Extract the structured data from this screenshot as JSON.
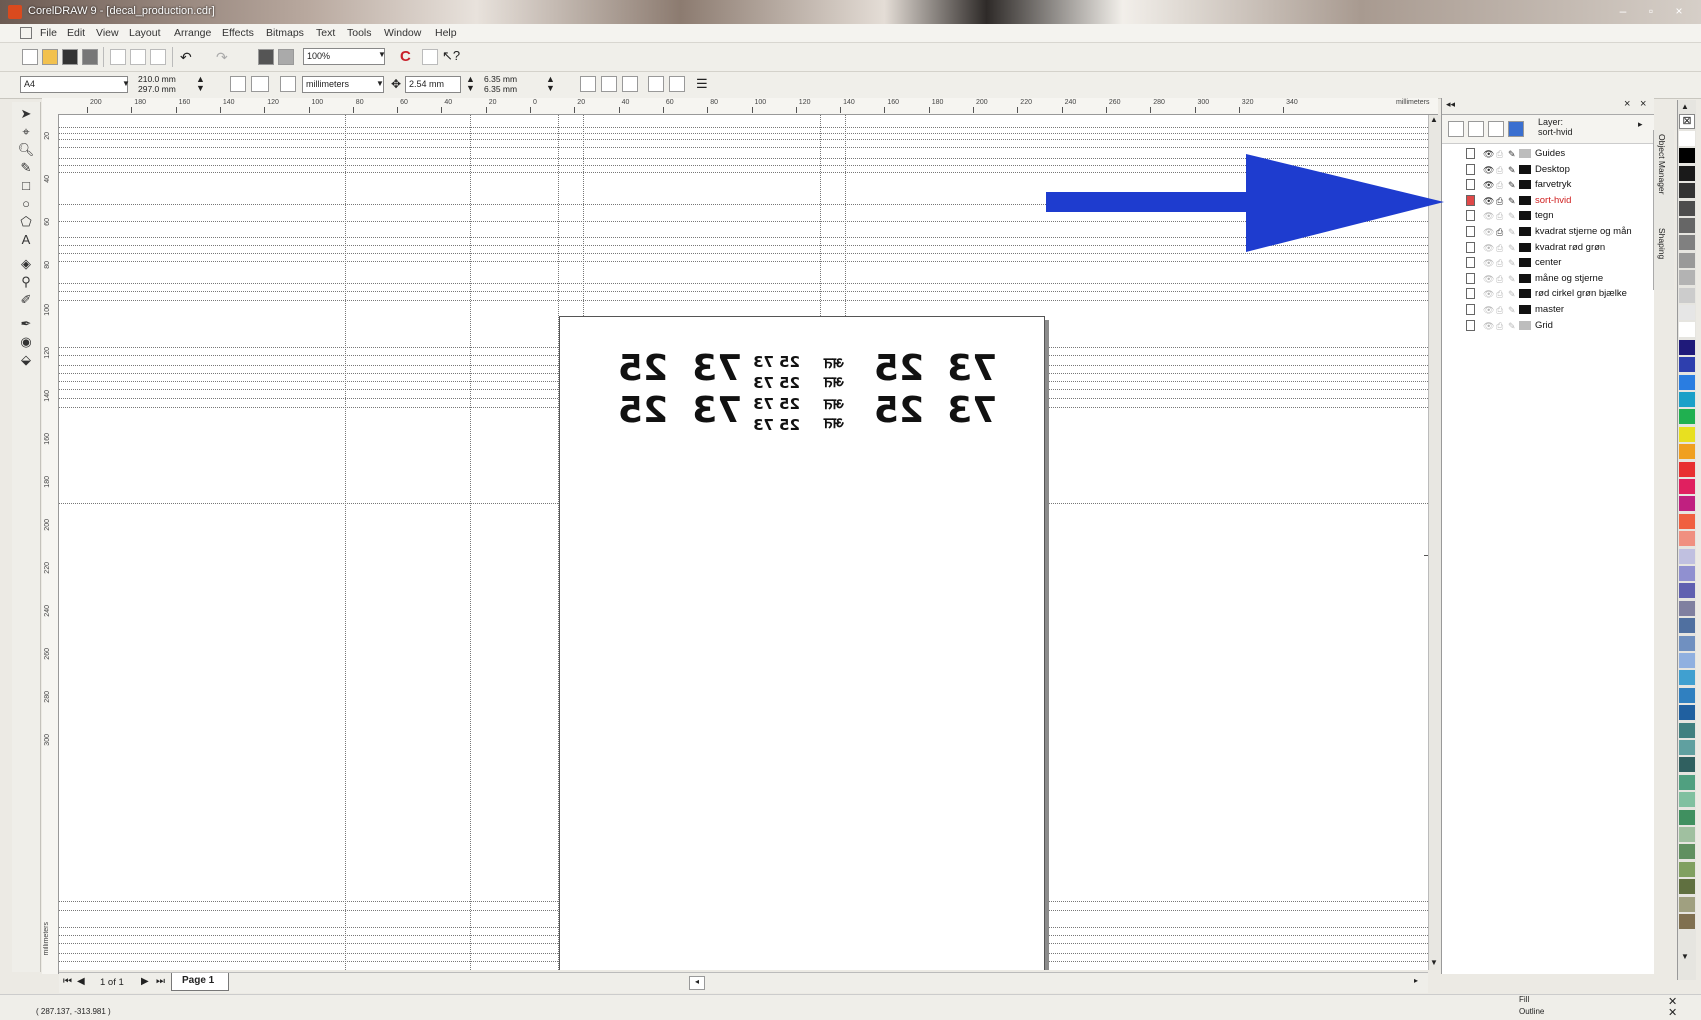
{
  "window": {
    "title": "CorelDRAW 9 - [decal_production.cdr]",
    "controls": [
      "–",
      "▫",
      "×"
    ]
  },
  "menu": [
    "File",
    "Edit",
    "View",
    "Layout",
    "Arrange",
    "Effects",
    "Bitmaps",
    "Text",
    "Tools",
    "Window",
    "Help"
  ],
  "toolbar": {
    "zoom": "100%"
  },
  "property_bar": {
    "paper_size": "A4",
    "width": "210.0 mm",
    "height": "297.0 mm",
    "units": "millimeters",
    "nudge": "2.54 mm",
    "dup_x": "6.35 mm",
    "dup_y": "6.35 mm"
  },
  "ruler": {
    "unit_label": "millimeters",
    "h_ticks": [
      "200",
      "180",
      "160",
      "140",
      "120",
      "100",
      "80",
      "60",
      "40",
      "20",
      "0",
      "20",
      "40",
      "60",
      "80",
      "100",
      "120",
      "140",
      "160",
      "180",
      "200",
      "220",
      "240",
      "260",
      "280",
      "300",
      "320",
      "340"
    ],
    "v_ticks": [
      "20",
      "40",
      "60",
      "80",
      "100",
      "120",
      "140",
      "160",
      "180",
      "200",
      "220",
      "240",
      "260",
      "280",
      "300"
    ],
    "v_unit_label": "millimeters"
  },
  "page_content": {
    "rows": [
      [
        "25",
        "73",
        "25",
        "73"
      ],
      [
        "25",
        "73",
        "25",
        "73"
      ]
    ],
    "small": {
      "col1": [
        "25 73",
        "25 73",
        "25 73",
        "25 73"
      ],
      "col2": [
        "अत",
        "अत",
        "अत",
        "अत"
      ]
    }
  },
  "page_nav": {
    "counter": "1 of 1",
    "page_tab": "Page 1"
  },
  "status": {
    "coords": "( 287.137, -313.981 )",
    "fill_label": "Fill",
    "outline_label": "Outline"
  },
  "layers_docker": {
    "title_line1": "Layer:",
    "title_line2": "sort-hvid",
    "tabs": [
      "Object Manager",
      "Shaping"
    ],
    "layers": [
      {
        "name": "Guides",
        "active": false
      },
      {
        "name": "Desktop",
        "active": false
      },
      {
        "name": "farvetryk",
        "active": false
      },
      {
        "name": "sort-hvid",
        "active": true
      },
      {
        "name": "tegn",
        "active": false
      },
      {
        "name": "kvadrat stjerne og mån",
        "active": false
      },
      {
        "name": "kvadrat rød grøn",
        "active": false
      },
      {
        "name": "center",
        "active": false
      },
      {
        "name": "måne og stjerne",
        "active": false
      },
      {
        "name": "rød cirkel grøn bjælke",
        "active": false
      },
      {
        "name": "master",
        "active": false
      },
      {
        "name": "Grid",
        "active": false
      }
    ]
  },
  "palette_colors": [
    "#ffffff",
    "#000000",
    "#1a1a1a",
    "#333333",
    "#4d4d4d",
    "#666666",
    "#808080",
    "#999999",
    "#b3b3b3",
    "#cccccc",
    "#e6e6e6",
    "#ffffff",
    "#1f1a7a",
    "#2e3fae",
    "#2a7de1",
    "#1aa0c8",
    "#20b050",
    "#e8e020",
    "#f0a020",
    "#e83030",
    "#e02060",
    "#c02080",
    "#f06040",
    "#f09080",
    "#c0c0e0",
    "#9090d0",
    "#6060b0",
    "#8080a0",
    "#5070a0",
    "#7090c0",
    "#90b0e0",
    "#40a0d0",
    "#3080c0",
    "#2060a0",
    "#408080",
    "#60a0a0",
    "#306060",
    "#50a080",
    "#80c0a0",
    "#409060",
    "#a0c0a0",
    "#609060",
    "#80a060",
    "#607040",
    "#a0a080",
    "#807050"
  ],
  "annotation_arrow_color": "#1e3ccf"
}
